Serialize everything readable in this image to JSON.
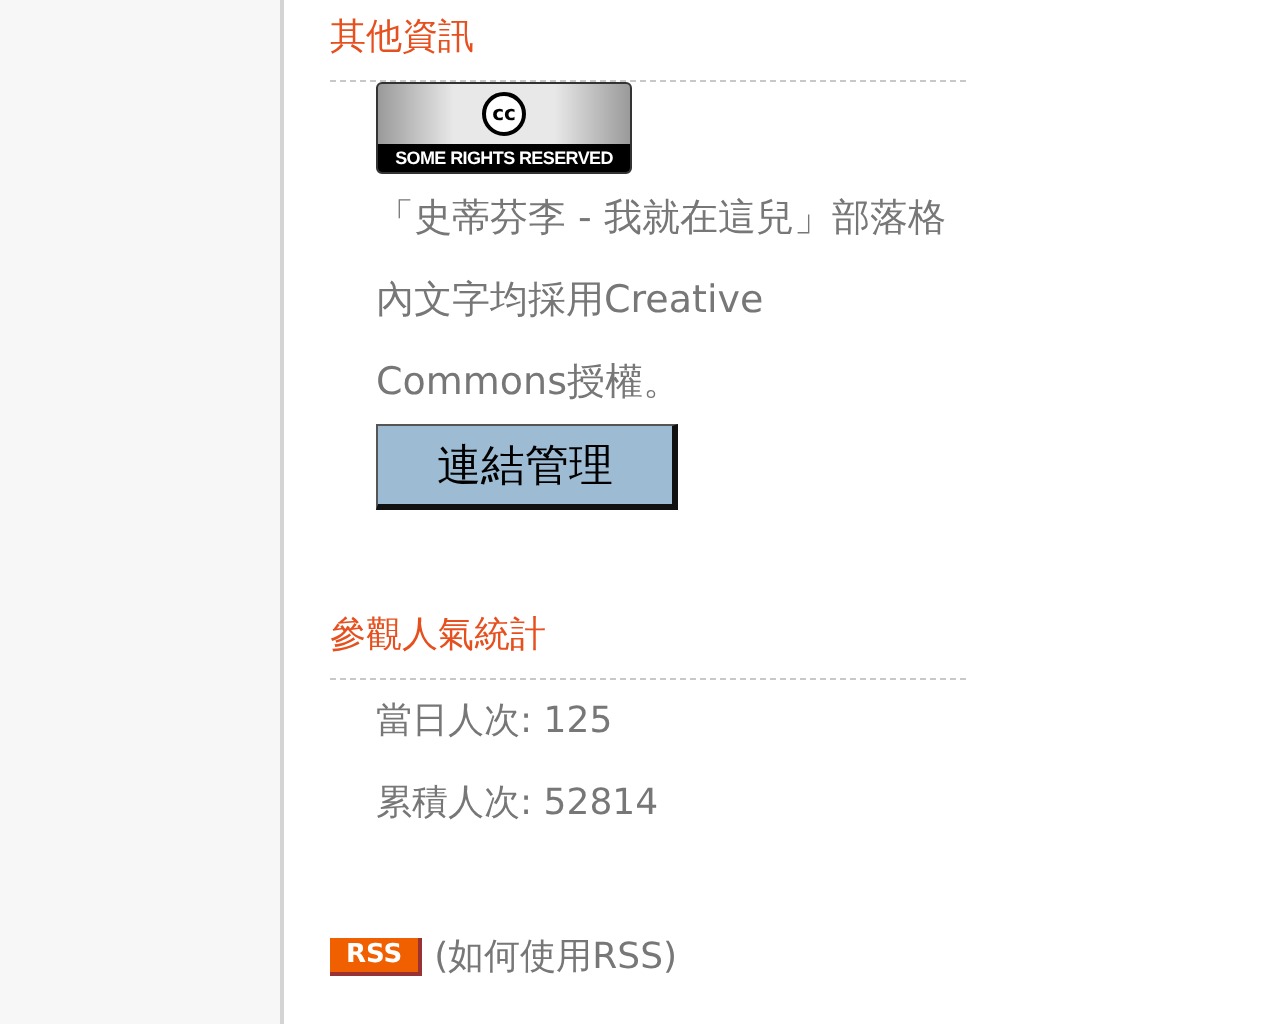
{
  "sections": [
    {
      "heading": "其他資訊",
      "kind": "license",
      "badge": {
        "symbol": "cc",
        "caption": "SOME RIGHTS RESERVED"
      },
      "text": "「史蒂芬李 - 我就在這兒」部落格內文字均採用Creative Commons授權。",
      "button": "連結管理"
    },
    {
      "heading": "參觀人氣統計",
      "kind": "stats",
      "lines": [
        "當日人次: 125",
        "累積人次: 52814"
      ]
    }
  ],
  "rss": {
    "badge": "RSS",
    "link": "(如何使用RSS)"
  }
}
